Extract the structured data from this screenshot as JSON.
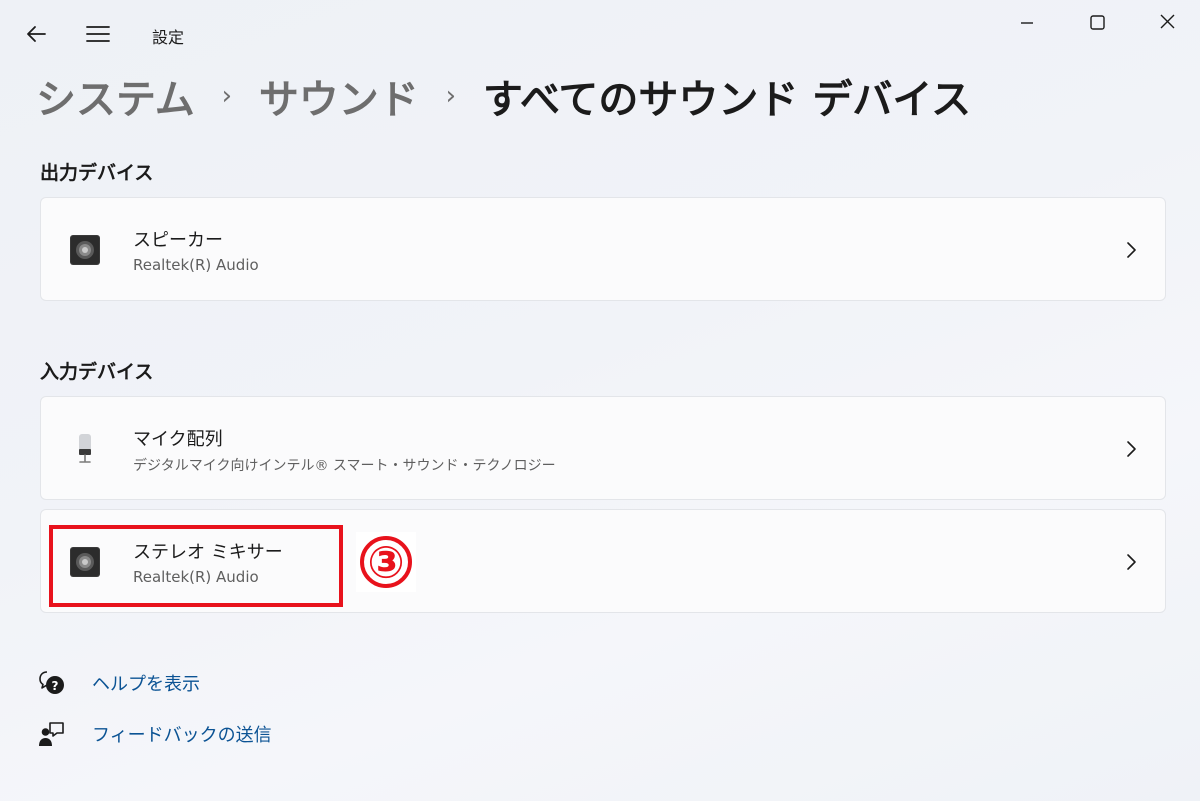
{
  "titlebar": {
    "title": "設定",
    "back_icon": "back-arrow-icon",
    "menu_icon": "hamburger-menu-icon",
    "window_controls": [
      "minimize-icon",
      "maximize-icon",
      "close-icon"
    ]
  },
  "breadcrumb": {
    "items": [
      "システム",
      "サウンド",
      "すべてのサウンド デバイス"
    ],
    "separator": "›"
  },
  "sections": {
    "output": {
      "label": "出力デバイス",
      "devices": [
        {
          "name": "スピーカー",
          "detail": "Realtek(R) Audio",
          "icon": "speaker-icon"
        }
      ]
    },
    "input": {
      "label": "入力デバイス",
      "devices": [
        {
          "name": "マイク配列",
          "detail": "デジタルマイク向けインテル® スマート・サウンド・テクノロジー",
          "icon": "microphone-icon"
        },
        {
          "name": "ステレオ ミキサー",
          "detail": "Realtek(R) Audio",
          "icon": "speaker-icon"
        }
      ]
    }
  },
  "annotation": {
    "step_number": "③",
    "color": "#e8121c"
  },
  "links": [
    {
      "label": "ヘルプを表示",
      "icon": "help-chat-icon"
    },
    {
      "label": "フィードバックの送信",
      "icon": "feedback-person-icon"
    }
  ],
  "colors": {
    "link": "#0b5394",
    "highlight": "#e8121c",
    "card_background": "#fbfbfc"
  }
}
